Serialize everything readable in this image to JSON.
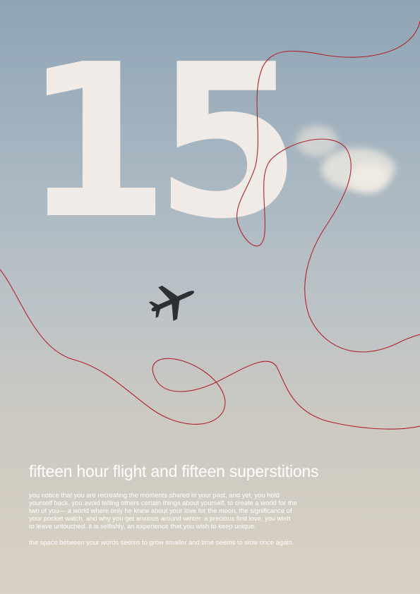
{
  "poster": {
    "number": "15",
    "title": "fifteen hour flight and fifteen superstitions",
    "paragraphs": [
      "you notice that you are recreating the moments shared in your past, and yet, you hold yourself back. you avoid telling others certain things about yourself, to create a world for the two of you— a world where only he knew about your love for the moon, the significance of your pocket watch, and why you get anxious around winter. a precious first love, you wish to leave untouched. it is selfishly, an experience that you wish to keep unique.",
      "the space between your words seems to grow smaller and time seems to slow once again."
    ]
  },
  "colors": {
    "number": "#f1ebe7",
    "thread": "#b0222a",
    "text": "#ffffff",
    "sky_top": "#8fa4b5",
    "sky_bottom": "#d9d1c3"
  },
  "icons": {
    "airplane": "airplane-icon"
  }
}
